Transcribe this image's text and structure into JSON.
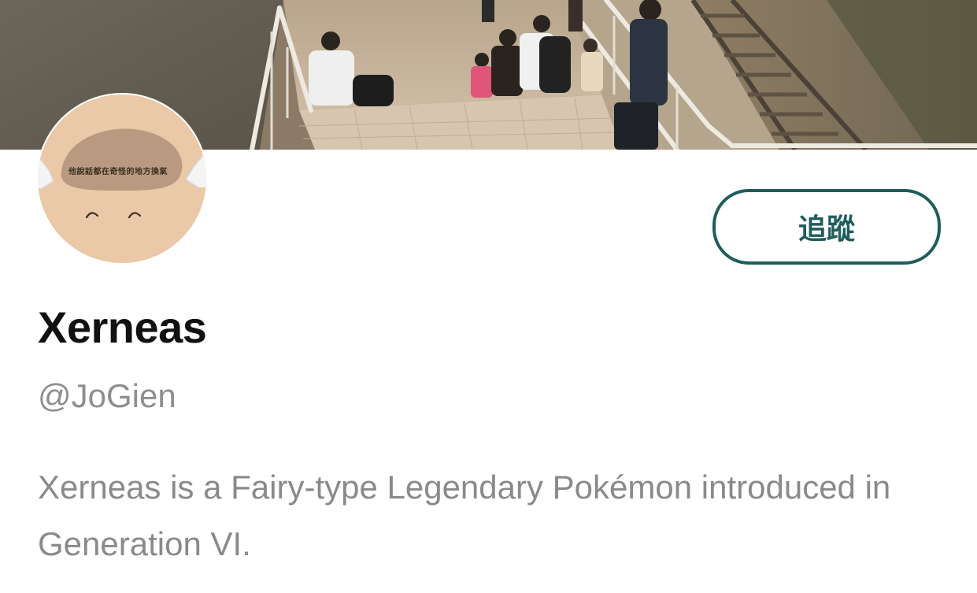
{
  "profile": {
    "banner_icon": "photo-banner",
    "avatar_icon": "cartoon-face-avatar",
    "avatar_caption": "他說話都在奇怪的地方換氣",
    "follow_label": "追蹤",
    "display_name": "Xerneas",
    "handle": "@JoGien",
    "bio": "Xerneas is a Fairy-type Legendary Pokémon introduced in Generation VI."
  },
  "colors": {
    "accent": "#1f5d5c",
    "name_text": "#111111",
    "secondary_text": "#8e8e8e",
    "avatar_skin": "#eac8a8"
  }
}
